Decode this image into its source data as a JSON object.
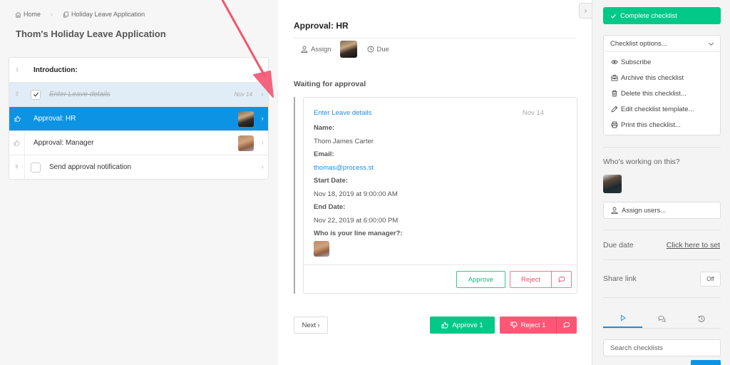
{
  "breadcrumb": {
    "home_label": "Home",
    "current_label": "Holiday Leave Application"
  },
  "page_title": "Thom's Holiday Leave Application",
  "tasks": [
    {
      "num": "1",
      "label": "Introduction:",
      "type": "heading"
    },
    {
      "num": "2",
      "label": "Enter Leave details",
      "date": "Nov 14",
      "checked": true,
      "type": "done"
    },
    {
      "label": "Approval: HR",
      "icon": "thumbs-up-icon",
      "type": "active",
      "assignee": "female"
    },
    {
      "label": "Approval: Manager",
      "icon": "thumbs-up-icon",
      "type": "approval",
      "assignee": "male"
    },
    {
      "num": "5",
      "label": "Send approval notification",
      "checked": false,
      "type": "task"
    }
  ],
  "step": {
    "title": "Approval: HR",
    "assign_label": "Assign",
    "due_label": "Due",
    "waiting_label": "Waiting for approval"
  },
  "card": {
    "title": "Enter Leave details",
    "date": "Nov 14",
    "fields": [
      {
        "label": "Name:",
        "value": "Thom James Carter"
      },
      {
        "label": "Email:",
        "value": "thomas@process.st"
      },
      {
        "label": "Start Date:",
        "value": "Nov 18, 2019 at 9:00:00 AM"
      },
      {
        "label": "End Date:",
        "value": "Nov 22, 2019 at 6:00:00 PM"
      },
      {
        "label": "Who is your line manager?:"
      }
    ],
    "approve_label": "Approve",
    "reject_label": "Reject"
  },
  "footer": {
    "next_label": "Next",
    "approve_all_label": "Approve 1",
    "reject_all_label": "Reject 1"
  },
  "sidebar": {
    "complete_label": "Complete checklist",
    "options_label": "Checklist options...",
    "options": [
      {
        "label": "Subscribe",
        "icon": "eye-icon"
      },
      {
        "label": "Archive this checklist",
        "icon": "archive-icon"
      },
      {
        "label": "Delete this checklist...",
        "icon": "trash-icon"
      },
      {
        "label": "Edit checklist template...",
        "icon": "pencil-icon"
      },
      {
        "label": "Print this checklist...",
        "icon": "printer-icon"
      }
    ],
    "who_label": "Who's working on this?",
    "assign_users_label": "Assign users...",
    "due_date_label": "Due date",
    "due_date_link": "Click here to set",
    "share_link_label": "Share link",
    "share_toggle": "Off",
    "search_placeholder": "Search checklists"
  },
  "colors": {
    "primary_blue": "#0d93e4",
    "green": "#02c987",
    "red": "#fe5776",
    "annotation": "#f2566f"
  }
}
